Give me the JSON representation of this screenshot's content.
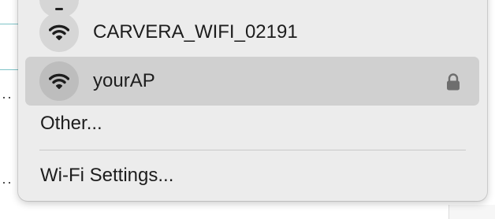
{
  "wifi_menu": {
    "networks": [
      {
        "name": "CARVERA_WIFI_02191",
        "secured": false,
        "selected": false,
        "icon": "wifi-icon"
      },
      {
        "name": "yourAP",
        "secured": true,
        "selected": true,
        "icon": "wifi-icon"
      }
    ],
    "other_label": "Other...",
    "settings_label": "Wi-Fi Settings..."
  }
}
